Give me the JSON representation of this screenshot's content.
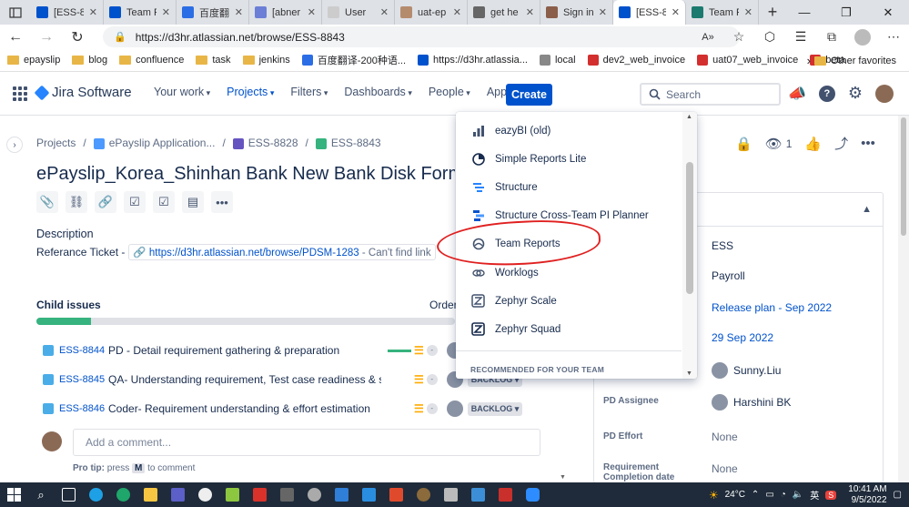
{
  "browser": {
    "tabs": [
      {
        "title": "[ESS-8",
        "favicon_color": "#0052cc",
        "favicon": "jira-icon"
      },
      {
        "title": "Team R",
        "favicon_color": "#0052cc",
        "favicon": "jira-icon"
      },
      {
        "title": "百度翻",
        "favicon_color": "#2b6de5",
        "favicon": "translate-icon"
      },
      {
        "title": "[abner",
        "favicon_color": "#6b7fd7",
        "favicon": "diamond-icon"
      },
      {
        "title": "User",
        "favicon_color": "#cccccc",
        "favicon": "page-icon"
      },
      {
        "title": "uat-ep",
        "favicon_color": "#b58b6e",
        "favicon": "avatar-icon"
      },
      {
        "title": "get he",
        "favicon_color": "#666666",
        "favicon": "search-icon"
      },
      {
        "title": "Sign in",
        "favicon_color": "#8b5e4a",
        "favicon": "avatar-icon"
      },
      {
        "title": "[ESS-8",
        "favicon_color": "#0052cc",
        "favicon": "jira-icon",
        "active": true
      },
      {
        "title": "Team R",
        "favicon_color": "#1b7a6e",
        "favicon": "team-icon"
      }
    ],
    "url": "https://d3hr.atlassian.net/browse/ESS-8843",
    "bookmarks": [
      {
        "label": "epayslip",
        "type": "folder"
      },
      {
        "label": "blog",
        "type": "folder"
      },
      {
        "label": "confluence",
        "type": "folder"
      },
      {
        "label": "task",
        "type": "folder"
      },
      {
        "label": "jenkins",
        "type": "folder"
      },
      {
        "label": "百度翻译-200种语...",
        "type": "link",
        "color": "#2b6de5"
      },
      {
        "label": "https://d3hr.atlassia...",
        "type": "link",
        "color": "#0052cc"
      },
      {
        "label": "local",
        "type": "link",
        "color": "#888888"
      },
      {
        "label": "dev2_web_invoice",
        "type": "link",
        "color": "#d32f2f"
      },
      {
        "label": "uat07_web_invoice",
        "type": "link",
        "color": "#d32f2f"
      },
      {
        "label": "beta",
        "type": "link",
        "color": "#d32f2f"
      }
    ],
    "other_favorites": "Other favorites"
  },
  "header": {
    "product": "Jira Software",
    "nav": [
      {
        "label": "Your work",
        "active": false
      },
      {
        "label": "Projects",
        "active": true
      },
      {
        "label": "Filters",
        "active": false
      },
      {
        "label": "Dashboards",
        "active": false
      },
      {
        "label": "People",
        "active": false
      },
      {
        "label": "Apps",
        "active": false
      }
    ],
    "create": "Create",
    "search_placeholder": "Search"
  },
  "breadcrumb": [
    "Projects",
    "ePayslip Application...",
    "ESS-8828",
    "ESS-8843"
  ],
  "issue": {
    "title": "ePayslip_Korea_Shinhan Bank New Bank Disk Format in",
    "description_heading": "Description",
    "description_prefix": "Referance Ticket -",
    "link_url": "https://d3hr.atlassian.net/browse/PDSM-1283",
    "link_note": "- Can't find link",
    "child_heading": "Child issues",
    "order_label": "Order",
    "progress": 0.13,
    "watchers": "1"
  },
  "children": [
    {
      "key": "ESS-8844",
      "summary": "PD - Detail requirement gathering & preparation",
      "status": ""
    },
    {
      "key": "ESS-8845",
      "summary": "QA- Understanding requirement, Test case readiness & sign-off",
      "status": "BACKLOG"
    },
    {
      "key": "ESS-8846",
      "summary": "Coder- Requirement understanding & effort estimation",
      "status": "BACKLOG"
    }
  ],
  "comment": {
    "placeholder": "Add a comment...",
    "protip_prefix": "Pro tip:",
    "protip_press": "press",
    "protip_key": "M",
    "protip_suffix": "to comment"
  },
  "details": {
    "project": "ESS",
    "module": "Payroll",
    "release": "Release plan - Sep 2022",
    "due": "29 Sep 2022",
    "reporter": "Sunny.Liu",
    "pd_assignee_label": "PD Assignee",
    "pd_assignee": "Harshini BK",
    "pd_effort_label": "PD Effort",
    "pd_effort": "None",
    "req_date_label": "Requirement Completion date",
    "req_date": "None"
  },
  "apps_menu": {
    "items": [
      {
        "label": "eazyBI (old)",
        "icon": "bar-chart-icon"
      },
      {
        "label": "Simple Reports Lite",
        "icon": "pie-chart-icon"
      },
      {
        "label": "Structure",
        "icon": "structure-icon"
      },
      {
        "label": "Structure Cross-Team PI Planner",
        "icon": "planner-icon"
      },
      {
        "label": "Team Reports",
        "icon": "team-reports-icon"
      },
      {
        "label": "Worklogs",
        "icon": "worklogs-icon"
      },
      {
        "label": "Zephyr Scale",
        "icon": "zephyr-scale-icon"
      },
      {
        "label": "Zephyr Squad",
        "icon": "zephyr-squad-icon"
      }
    ],
    "section": "RECOMMENDED FOR YOUR TEAM"
  },
  "taskbar": {
    "temperature": "24°C",
    "ime": "英",
    "time": "10:41 AM",
    "date": "9/5/2022"
  }
}
